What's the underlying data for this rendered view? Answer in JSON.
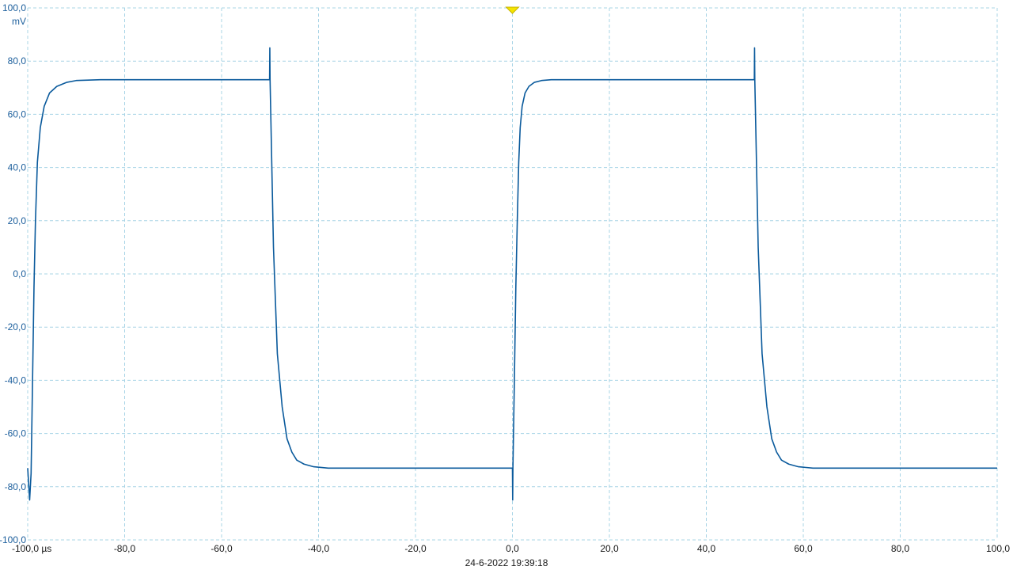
{
  "chart_data": {
    "type": "line",
    "xlabel": "",
    "ylabel": "",
    "x_unit": "µs",
    "y_unit": "mV",
    "xlim": [
      -100,
      100
    ],
    "ylim": [
      -100,
      100
    ],
    "x_tick_values": [
      -100,
      -80,
      -60,
      -40,
      -20,
      0,
      20,
      40,
      60,
      80,
      100
    ],
    "x_tick_labels": [
      "-100,0 µs",
      "-80,0",
      "-60,0",
      "-40,0",
      "-20,0",
      "0,0",
      "20,0",
      "40,0",
      "60,0",
      "80,0",
      "100,0"
    ],
    "y_tick_values": [
      100,
      80,
      60,
      40,
      20,
      0,
      -20,
      -40,
      -60,
      -80,
      -100
    ],
    "y_tick_labels": [
      "100,0",
      "80,0",
      "60,0",
      "40,0",
      "20,0",
      "0,0",
      "-20,0",
      "-40,0",
      "-60,0",
      "-80,0",
      "-100,0"
    ],
    "grid": true,
    "trigger_marker": {
      "x": 0,
      "color": "#f5e400"
    },
    "series": [
      {
        "color": "#0a5a9c",
        "x": [
          -100,
          -99.6,
          -99.3,
          -99.0,
          -98.7,
          -98.4,
          -98.0,
          -97.4,
          -96.6,
          -95.5,
          -94.0,
          -92.0,
          -90.0,
          -85.0,
          -75.0,
          -65.0,
          -55.0,
          -50.1,
          -50.05,
          -50.0,
          -49.8,
          -49.3,
          -48.5,
          -47.5,
          -46.5,
          -45.5,
          -44.5,
          -43.0,
          -41.0,
          -38.0,
          -34.0,
          -25.0,
          -15.0,
          -5.0,
          0,
          0.05,
          0.1,
          0.4,
          0.7,
          1.0,
          1.3,
          1.6,
          2.0,
          2.6,
          3.4,
          4.5,
          6.0,
          8.0,
          10.0,
          15.0,
          25.0,
          35.0,
          45.0,
          49.9,
          49.95,
          50.0,
          50.2,
          50.7,
          51.5,
          52.5,
          53.5,
          54.5,
          55.5,
          57.0,
          59.0,
          62.0,
          66.0,
          75.0,
          85.0,
          95.0,
          100.0
        ],
        "y": [
          -73,
          -85,
          -75,
          -40,
          -5,
          20,
          42,
          55,
          63,
          68,
          70.5,
          72,
          72.7,
          73,
          73,
          73,
          73,
          73,
          85,
          73,
          55,
          10,
          -30,
          -50,
          -62,
          -67,
          -70,
          -71.5,
          -72.5,
          -73,
          -73,
          -73,
          -73,
          -73,
          -73,
          -85,
          -73,
          -40,
          -5,
          20,
          42,
          55,
          63,
          68,
          70.5,
          72,
          72.7,
          73,
          73,
          73,
          73,
          73,
          73,
          73,
          85,
          73,
          55,
          10,
          -30,
          -50,
          -62,
          -67,
          -70,
          -71.5,
          -72.5,
          -73,
          -73,
          -73,
          -73,
          -73,
          -73
        ]
      }
    ]
  },
  "footer": {
    "timestamp": "24-6-2022 19:39:18"
  }
}
